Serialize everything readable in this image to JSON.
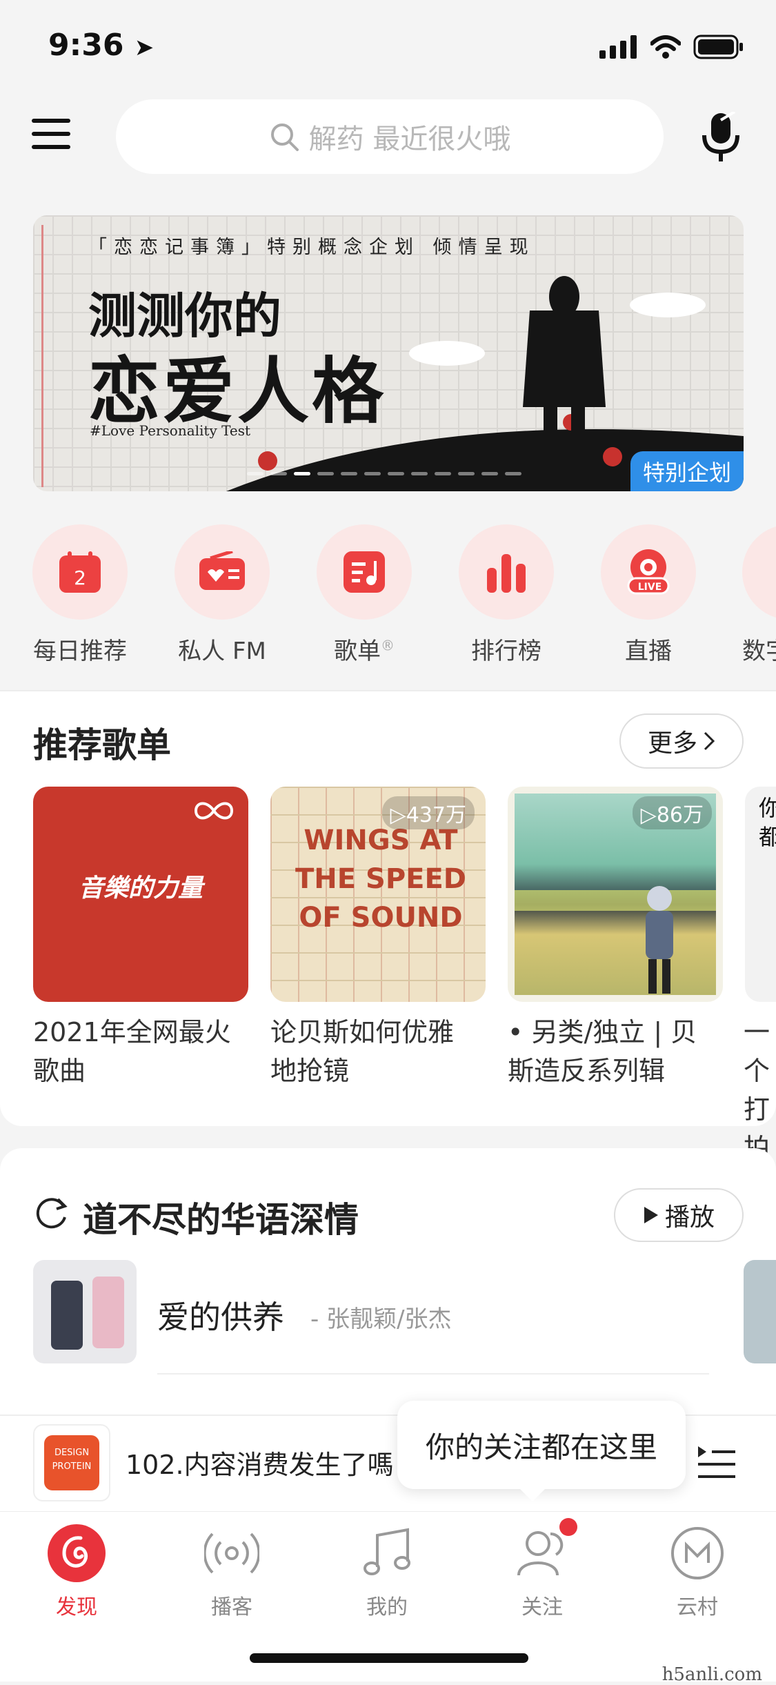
{
  "status": {
    "time": "9:36"
  },
  "search": {
    "placeholder": "解药 最近很火哦"
  },
  "banner": {
    "top_line": "「恋恋记事簿」特别概念企划   倾情呈现",
    "line1": "测测你的",
    "line2": "恋爱人格",
    "line3": "#Love Personality Test",
    "tag": "特别企划"
  },
  "quick": [
    {
      "label": "每日推荐",
      "icon": "calendar-icon",
      "badge": "2"
    },
    {
      "label": "私人 FM",
      "icon": "radio-icon"
    },
    {
      "label": "歌单",
      "icon": "playlist-icon"
    },
    {
      "label": "排行榜",
      "icon": "chart-icon"
    },
    {
      "label": "直播",
      "icon": "live-icon",
      "badge": "LIVE"
    },
    {
      "label": "数字"
    }
  ],
  "recommend": {
    "title": "推荐歌单",
    "more": "更多",
    "items": [
      {
        "caption": "2021年全网最火歌曲",
        "cover_text": "音樂的力量"
      },
      {
        "caption": "论贝斯如何优雅地抢镜",
        "plays": "437万",
        "cover_text": "WINGS AT THE SPEED OF SOUND"
      },
      {
        "caption": "• 另类/独立 | 贝斯造反系列辑",
        "plays": "86万"
      },
      {
        "caption": "一个打拍",
        "cover_text": "你都"
      }
    ]
  },
  "section2": {
    "title": "道不尽的华语深情",
    "play": "播放",
    "song_title": "爱的供养",
    "song_artist": "- 张靓颖/张杰"
  },
  "player": {
    "track": "102.内容消费发生了嗎",
    "cover_line1": "DESIGN",
    "cover_line2": "PROTEIN"
  },
  "tooltip": "你的关注都在这里",
  "tabs": [
    {
      "label": "发现"
    },
    {
      "label": "播客"
    },
    {
      "label": "我的"
    },
    {
      "label": "关注"
    },
    {
      "label": "云村"
    }
  ],
  "watermark": "h5anli.com",
  "colors": {
    "accent": "#e8333c",
    "accent_light": "#fbe7e6",
    "banner_tag": "#2f8fe8"
  }
}
